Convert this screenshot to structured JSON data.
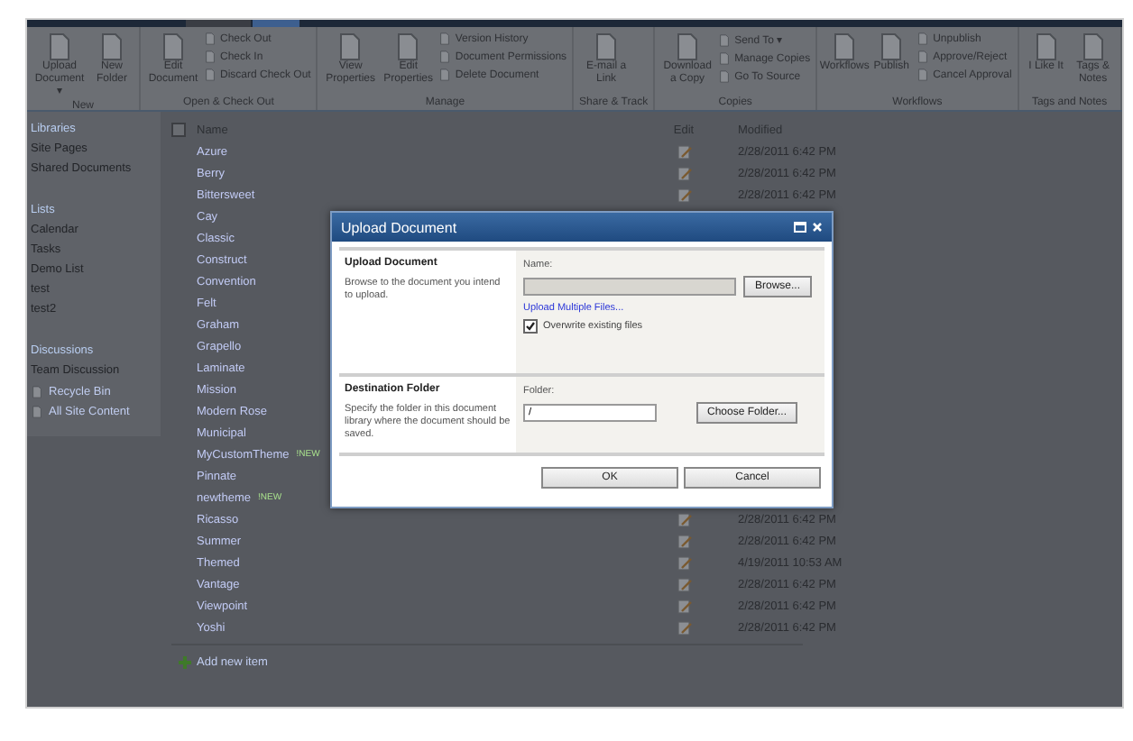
{
  "ribbon": {
    "groups": [
      {
        "label": "New",
        "large": [
          "Upload Document ▾",
          "New Folder"
        ]
      },
      {
        "label": "Open & Check Out",
        "large": [
          "Edit Document"
        ],
        "small": [
          "Check Out",
          "Check In",
          "Discard Check Out"
        ]
      },
      {
        "label": "Manage",
        "large": [
          "View Properties",
          "Edit Properties"
        ],
        "small": [
          "Version History",
          "Document Permissions",
          "Delete Document"
        ]
      },
      {
        "label": "Share & Track",
        "large": [
          "E-mail a Link"
        ]
      },
      {
        "label": "Copies",
        "large": [
          "Download a Copy"
        ],
        "small": [
          "Send To ▾",
          "Manage Copies",
          "Go To Source"
        ]
      },
      {
        "label": "Workflows",
        "large": [
          "Workflows",
          "Publish"
        ],
        "small": [
          "Unpublish",
          "Approve/Reject",
          "Cancel Approval"
        ]
      },
      {
        "label": "Tags and Notes",
        "large": [
          "I Like It",
          "Tags & Notes"
        ]
      }
    ]
  },
  "nav": {
    "sections": [
      {
        "heading": "Libraries",
        "items": [
          "Site Pages",
          "Shared Documents"
        ]
      },
      {
        "heading": "Lists",
        "items": [
          "Calendar",
          "Tasks",
          "Demo List",
          "test",
          "test2"
        ]
      },
      {
        "heading": "Discussions",
        "items": [
          "Team Discussion"
        ]
      }
    ],
    "footer": [
      "Recycle Bin",
      "All Site Content"
    ]
  },
  "list": {
    "select_all": {
      "checked": false
    },
    "columns": [
      "Name",
      "Edit",
      "Modified"
    ],
    "rows": [
      {
        "name": "Azure",
        "modified": "2/28/2011 6:42 PM"
      },
      {
        "name": "Berry",
        "modified": "2/28/2011 6:42 PM"
      },
      {
        "name": "Bittersweet",
        "modified": "2/28/2011 6:42 PM"
      },
      {
        "name": "Cay"
      },
      {
        "name": "Classic"
      },
      {
        "name": "Construct"
      },
      {
        "name": "Convention"
      },
      {
        "name": "Felt"
      },
      {
        "name": "Graham"
      },
      {
        "name": "Grapello"
      },
      {
        "name": "Laminate"
      },
      {
        "name": "Mission"
      },
      {
        "name": "Modern Rose"
      },
      {
        "name": "Municipal"
      },
      {
        "name": "MyCustomTheme",
        "badge": "!NEW"
      },
      {
        "name": "Pinnate"
      },
      {
        "name": "newtheme",
        "badge": "!NEW"
      },
      {
        "name": "Ricasso",
        "modified": "2/28/2011 6:42 PM"
      },
      {
        "name": "Summer",
        "modified": "2/28/2011 6:42 PM"
      },
      {
        "name": "Themed",
        "modified": "4/19/2011 10:53 AM"
      },
      {
        "name": "Vantage",
        "modified": "2/28/2011 6:42 PM"
      },
      {
        "name": "Viewpoint",
        "modified": "2/28/2011 6:42 PM"
      },
      {
        "name": "Yoshi",
        "modified": "2/28/2011 6:42 PM"
      }
    ],
    "add_item": "Add new item"
  },
  "dialog": {
    "title": "Upload Document",
    "sections": [
      {
        "heading": "Upload Document",
        "description": "Browse to the document you intend to upload.",
        "field_label": "Name:",
        "button": "Browse...",
        "link": "Upload Multiple Files...",
        "checkbox": {
          "label": "Overwrite existing files",
          "checked": true
        }
      },
      {
        "heading": "Destination Folder",
        "description": "Specify the folder in this document library where the document should be saved.",
        "field_label": "Folder:",
        "value": "/",
        "button": "Choose Folder..."
      }
    ],
    "buttons": [
      "OK",
      "Cancel"
    ]
  }
}
